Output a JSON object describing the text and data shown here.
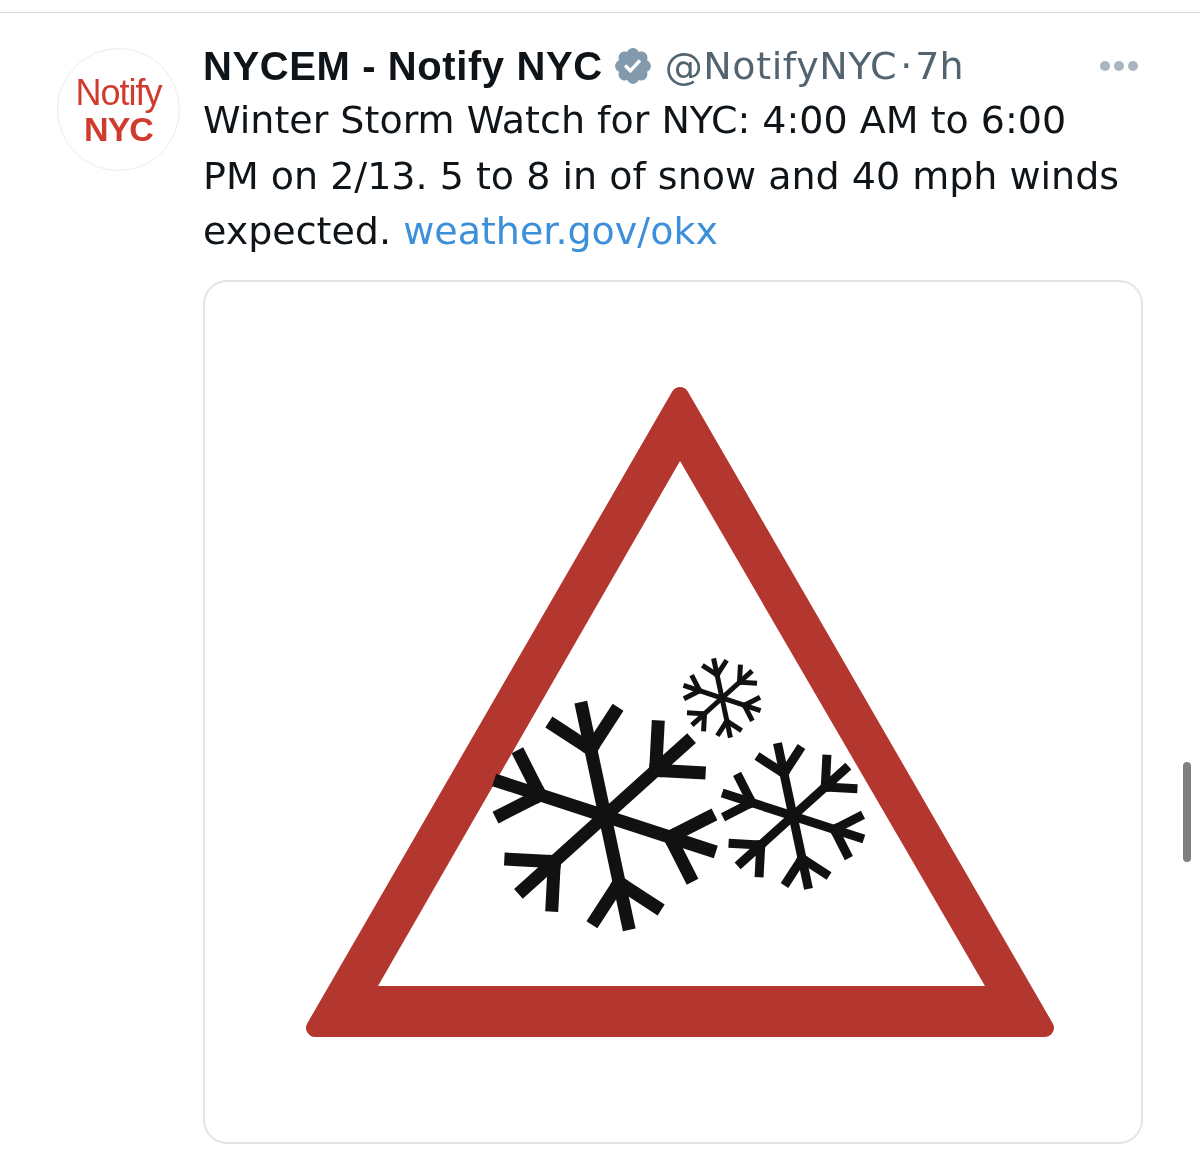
{
  "tweet": {
    "avatar": {
      "logo_line_1": "Notify",
      "logo_line_2": "NYC"
    },
    "author": {
      "name": "NYCEM - Notify NYC",
      "verified": true,
      "handle": "@NotifyNYC",
      "separator": "·",
      "time": "7h"
    },
    "text": "Winter Storm Watch for NYC: 4:00 AM to 6:00 PM on 2/13. 5 to 8 in of snow and 40 mph winds expected.",
    "link": "weather.gov/okx"
  }
}
